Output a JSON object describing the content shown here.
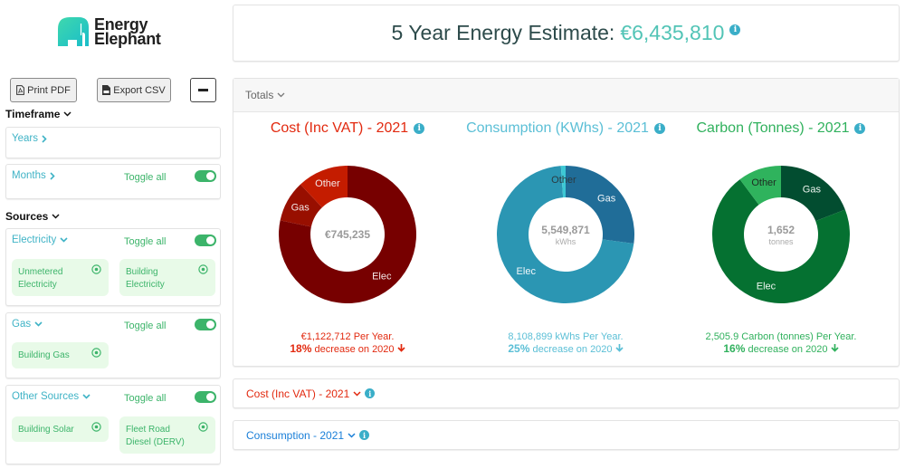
{
  "app": {
    "logo_line1": "Energy",
    "logo_line2": "Elephant"
  },
  "sidebar": {
    "buttons": {
      "print_pdf": "Print PDF",
      "export_csv": "Export CSV"
    },
    "timeframe": {
      "heading": "Timeframe",
      "years": {
        "label": "Years"
      },
      "months": {
        "label": "Months",
        "toggle_label": "Toggle all",
        "toggle_on": true
      }
    },
    "sources": {
      "heading": "Sources",
      "groups": [
        {
          "label": "Electricity",
          "toggle_label": "Toggle all",
          "toggle_on": true,
          "items": [
            {
              "label": "Unmetered Electricity",
              "selected": true
            },
            {
              "label": "Building Electricity",
              "selected": true
            }
          ]
        },
        {
          "label": "Gas",
          "toggle_label": "Toggle all",
          "toggle_on": true,
          "items": [
            {
              "label": "Building Gas",
              "selected": true
            }
          ]
        },
        {
          "label": "Other Sources",
          "toggle_label": "Toggle all",
          "toggle_on": true,
          "items": [
            {
              "label": "Building Solar",
              "selected": true
            },
            {
              "label": "Fleet Road Diesel (DERV)",
              "selected": true
            }
          ]
        }
      ]
    }
  },
  "header": {
    "title_prefix": "5 Year Energy Estimate:",
    "title_value": "€6,435,810"
  },
  "totals": {
    "label": "Totals",
    "cards": [
      {
        "per_year": "€1,122,712 Per Year.",
        "change_pct": "18%",
        "change_text": "decrease on 2020",
        "direction": "down"
      },
      {
        "per_year": "8,108,899 kWhs Per Year.",
        "change_pct": "25%",
        "change_text": "decrease on 2020",
        "direction": "down"
      },
      {
        "per_year": "2,505.9 Carbon (tonnes) Per Year.",
        "change_pct": "16%",
        "change_text": "decrease on 2020",
        "direction": "down"
      }
    ]
  },
  "sections": [
    {
      "label": "Cost (Inc VAT) - 2021",
      "expanded": false
    },
    {
      "label": "Consumption - 2021",
      "expanded": false
    }
  ],
  "chart_data": [
    {
      "type": "pie",
      "variant": "donut",
      "title": "Cost (Inc VAT) - 2021",
      "center_value": "€745,235",
      "center_unit": "",
      "value_unit": "percent share (estimated from arc angles)",
      "start": "top",
      "direction": "clockwise",
      "segments": [
        {
          "label": "Elec",
          "value": 78.3,
          "color": "#770000",
          "label_color": "#f3e8e8"
        },
        {
          "label": "Gas",
          "value": 9.7,
          "color": "#980f00",
          "label_color": "#f3e8e8"
        },
        {
          "label": "Other",
          "value": 12.0,
          "color": "#c41c00",
          "label_color": "#f3e8e8"
        }
      ]
    },
    {
      "type": "pie",
      "variant": "donut",
      "title": "Consumption (KWhs) - 2021",
      "center_value": "5,549,871",
      "center_unit": "kWhs",
      "value_unit": "percent share (estimated from arc angles)",
      "start": "top",
      "direction": "clockwise",
      "segments": [
        {
          "label": "Gas",
          "value": 27.1,
          "color": "#206d98",
          "label_color": "#f2f7fa"
        },
        {
          "label": "Elec",
          "value": 71.8,
          "color": "#2b96b3",
          "label_color": "#f2f7fa"
        },
        {
          "label": "Other",
          "value": 1.1,
          "color": "#3dc8d4",
          "label_color": "#2b3a40"
        }
      ]
    },
    {
      "type": "pie",
      "variant": "donut",
      "title": "Carbon (Tonnes) - 2021",
      "center_value": "1,652",
      "center_unit": "tonnes",
      "value_unit": "percent share (estimated from arc angles)",
      "start": "top",
      "direction": "clockwise",
      "segments": [
        {
          "label": "Gas",
          "value": 19.1,
          "color": "#024d30",
          "label_color": "#eef6f0"
        },
        {
          "label": "Elec",
          "value": 70.7,
          "color": "#057131",
          "label_color": "#eef6f0"
        },
        {
          "label": "Other",
          "value": 10.2,
          "color": "#2fb35d",
          "label_color": "#1e2a22"
        }
      ]
    }
  ]
}
